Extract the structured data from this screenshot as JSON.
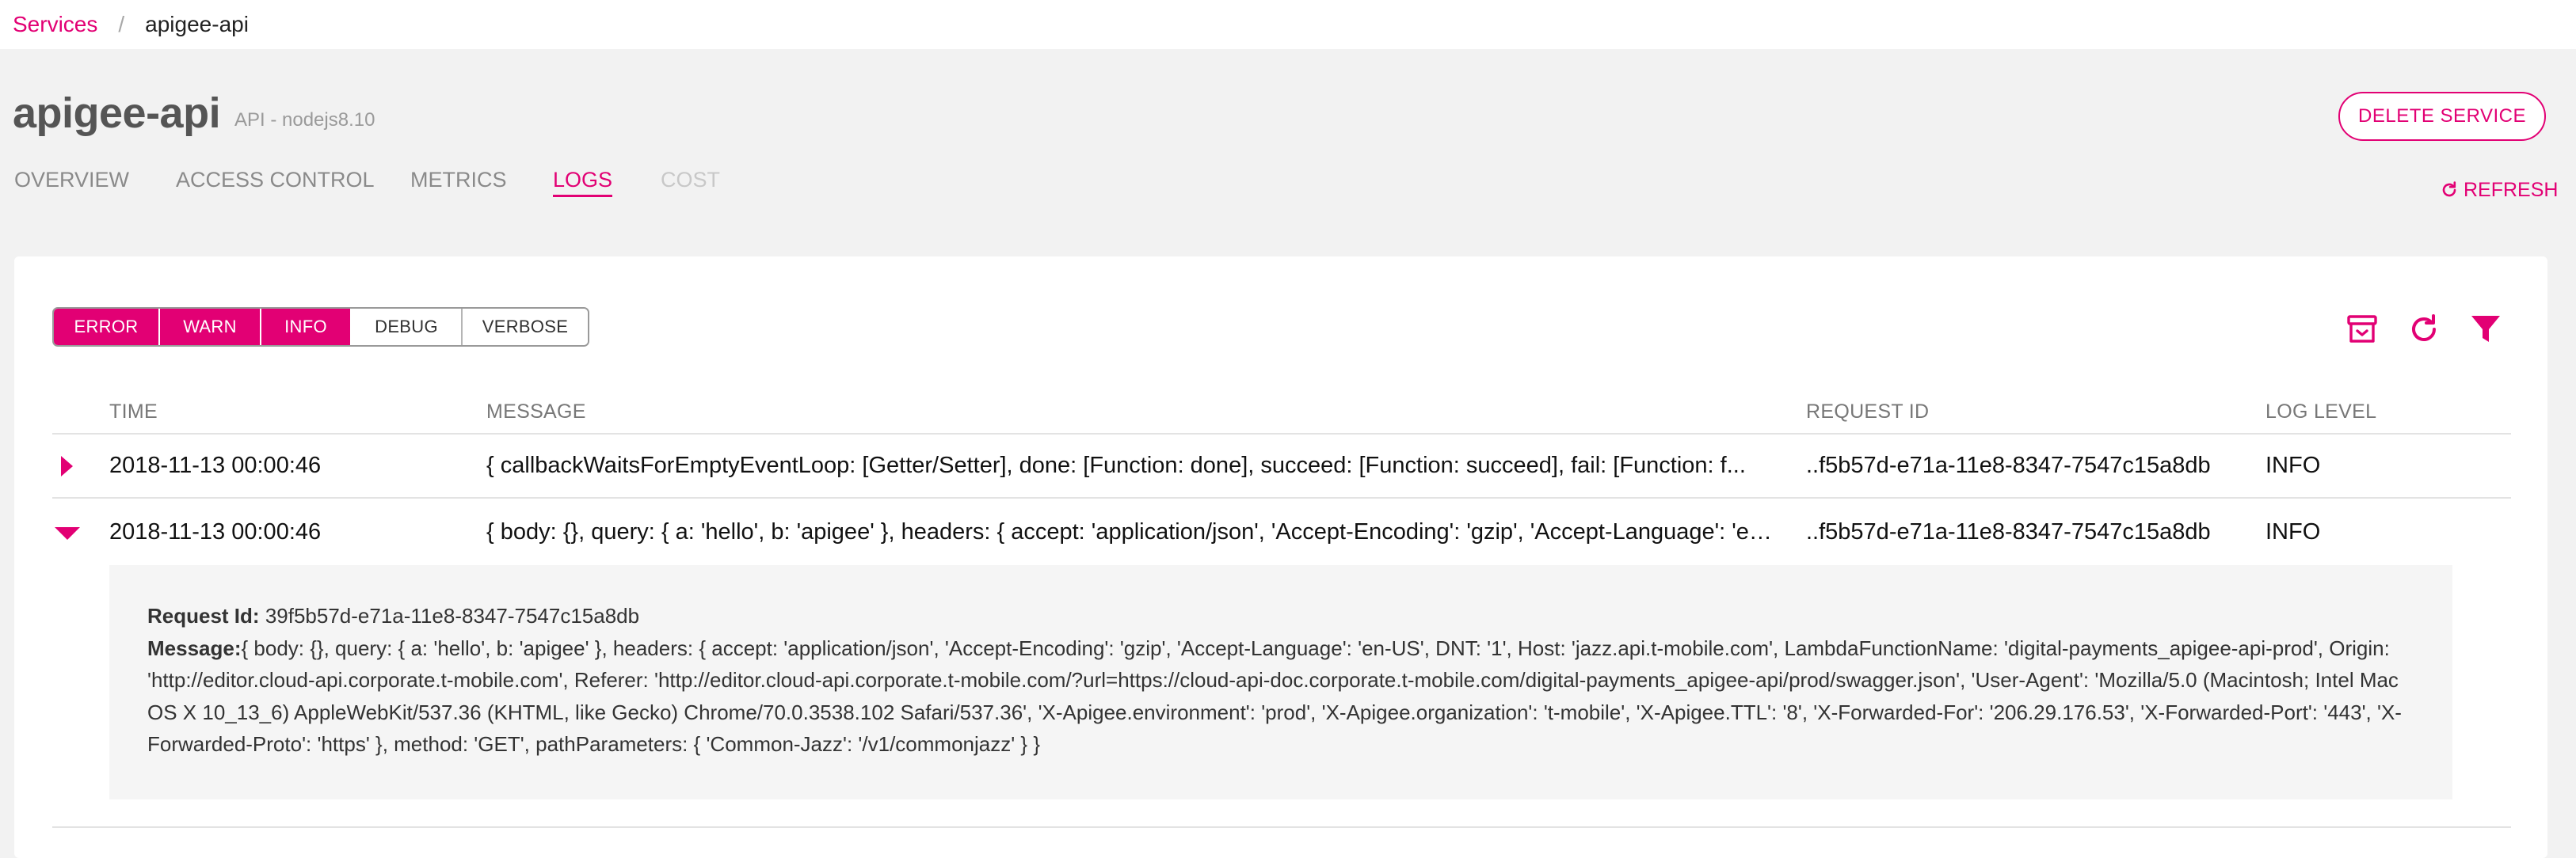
{
  "breadcrumb": {
    "root": "Services",
    "separator": "/",
    "current": "apigee-api"
  },
  "service": {
    "name": "apigee-api",
    "subtitle": "API - nodejs8.10"
  },
  "tabs": [
    {
      "label": "OVERVIEW"
    },
    {
      "label": "ACCESS CONTROL"
    },
    {
      "label": "METRICS"
    },
    {
      "label": "LOGS"
    },
    {
      "label": "COST"
    }
  ],
  "actions": {
    "delete_label": "DELETE SERVICE",
    "refresh_label": "REFRESH"
  },
  "filters": [
    {
      "label": "ERROR",
      "active": true
    },
    {
      "label": "WARN",
      "active": true
    },
    {
      "label": "INFO",
      "active": true
    },
    {
      "label": "DEBUG",
      "active": false
    },
    {
      "label": "VERBOSE",
      "active": false
    }
  ],
  "toolbar_icons": [
    "archive-icon",
    "refresh-icon",
    "filter-icon"
  ],
  "table": {
    "columns": [
      "TIME",
      "MESSAGE",
      "REQUEST ID",
      "LOG LEVEL"
    ],
    "rows": [
      {
        "expanded": false,
        "time": "2018-11-13 00:00:46",
        "message": "{ callbackWaitsForEmptyEventLoop: [Getter/Setter], done: [Function: done], succeed: [Function: succeed], fail: [Function: f...",
        "request_id": "..f5b57d-e71a-11e8-8347-7547c15a8db",
        "level": "INFO"
      },
      {
        "expanded": true,
        "time": "2018-11-13 00:00:46",
        "message": "{ body: {}, query: { a: 'hello', b: 'apigee' }, headers: { accept: 'application/json', 'Accept-Encoding': 'gzip', 'Accept-Language': 'en...",
        "request_id": "..f5b57d-e71a-11e8-8347-7547c15a8db",
        "level": "INFO"
      }
    ]
  },
  "detail": {
    "request_id_label": "Request Id:",
    "request_id_value": "39f5b57d-e71a-11e8-8347-7547c15a8db",
    "message_label": "Message:",
    "message_value": "{ body: {}, query: { a: 'hello', b: 'apigee' }, headers: { accept: 'application/json', 'Accept-Encoding': 'gzip', 'Accept-Language': 'en-US', DNT: '1', Host: 'jazz.api.t-mobile.com', LambdaFunctionName: 'digital-payments_apigee-api-prod', Origin: 'http://editor.cloud-api.corporate.t-mobile.com', Referer: 'http://editor.cloud-api.corporate.t-mobile.com/?url=https://cloud-api-doc.corporate.t-mobile.com/digital-payments_apigee-api/prod/swagger.json', 'User-Agent': 'Mozilla/5.0 (Macintosh; Intel Mac OS X 10_13_6) AppleWebKit/537.36 (KHTML, like Gecko) Chrome/70.0.3538.102 Safari/537.36', 'X-Apigee.environment': 'prod', 'X-Apigee.organization': 't-mobile', 'X-Apigee.TTL': '8', 'X-Forwarded-For': '206.29.176.53', 'X-Forwarded-Port': '443', 'X-Forwarded-Proto': 'https' }, method: 'GET', pathParameters: { 'Common-Jazz': '/v1/commonjazz' } }"
  },
  "colors": {
    "accent": "#e20074",
    "page_bg": "#f2f2f2",
    "card_bg": "#ffffff",
    "detail_bg": "#f5f5f5"
  }
}
